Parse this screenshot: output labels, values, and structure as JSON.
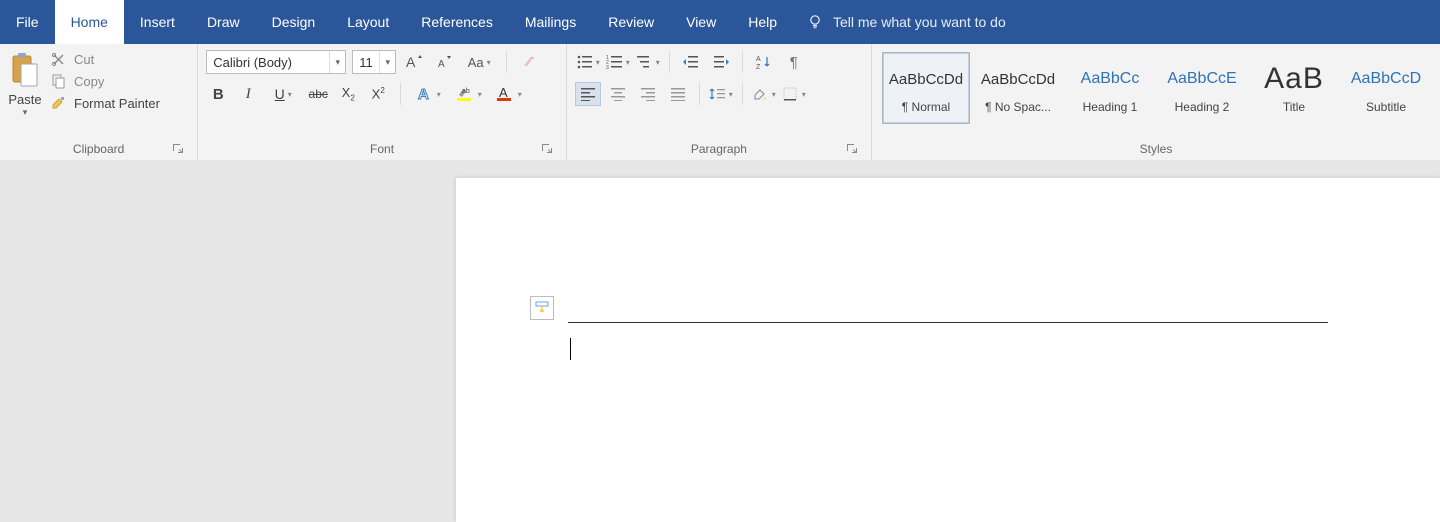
{
  "menu": {
    "tabs": [
      "File",
      "Home",
      "Insert",
      "Draw",
      "Design",
      "Layout",
      "References",
      "Mailings",
      "Review",
      "View",
      "Help"
    ],
    "active_index": 1,
    "tell_me": "Tell me what you want to do"
  },
  "clipboard": {
    "paste": "Paste",
    "cut": "Cut",
    "copy": "Copy",
    "format_painter": "Format Painter",
    "group_label": "Clipboard"
  },
  "font": {
    "name": "Calibri (Body)",
    "size": "11",
    "group_label": "Font"
  },
  "paragraph": {
    "group_label": "Paragraph"
  },
  "styles": {
    "group_label": "Styles",
    "items": [
      {
        "preview": "AaBbCcDd",
        "name": "¶ Normal",
        "kind": "normal",
        "selected": true
      },
      {
        "preview": "AaBbCcDd",
        "name": "¶ No Spac...",
        "kind": "normal"
      },
      {
        "preview": "AaBbCc",
        "name": "Heading 1",
        "kind": "heading"
      },
      {
        "preview": "AaBbCcE",
        "name": "Heading 2",
        "kind": "heading"
      },
      {
        "preview": "AaB",
        "name": "Title",
        "kind": "title"
      },
      {
        "preview": "AaBbCcD",
        "name": "Subtitle",
        "kind": "heading"
      }
    ]
  }
}
